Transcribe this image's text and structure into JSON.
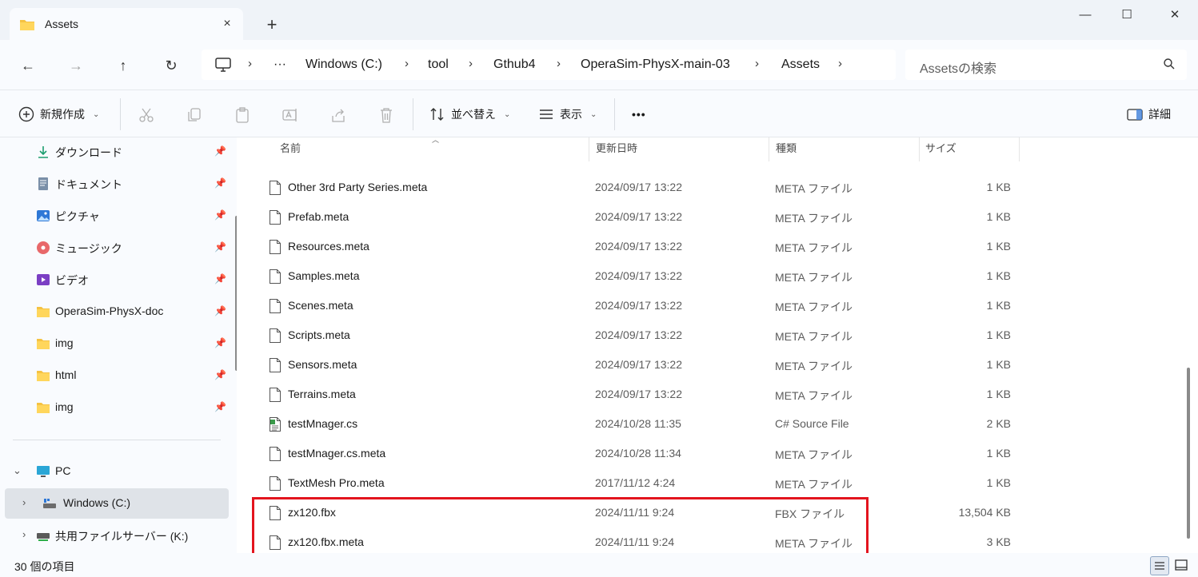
{
  "window": {
    "tab_title": "Assets",
    "tab_close": "×",
    "new_tab": "+",
    "minimize": "—",
    "maximize": "☐",
    "close": "✕"
  },
  "nav": {
    "back": "←",
    "forward": "→",
    "up": "↑",
    "refresh": "↻"
  },
  "breadcrumb": {
    "overflow": "···",
    "items": [
      "Windows (C:)",
      "tool",
      "Gthub4",
      "OperaSim-PhysX-main-03",
      "Assets"
    ],
    "separator": "›"
  },
  "search": {
    "placeholder": "Assetsの検索"
  },
  "toolbar": {
    "new_label": "新規作成",
    "sort_label": "並べ替え",
    "view_label": "表示",
    "more_label": "•••",
    "details_label": "詳細"
  },
  "sidebar": {
    "quick_access": [
      {
        "label": "ダウンロード",
        "icon": "download-icon"
      },
      {
        "label": "ドキュメント",
        "icon": "document-icon"
      },
      {
        "label": "ピクチャ",
        "icon": "pictures-icon"
      },
      {
        "label": "ミュージック",
        "icon": "music-icon"
      },
      {
        "label": "ビデオ",
        "icon": "video-icon"
      },
      {
        "label": "OperaSim-PhysX-doc",
        "icon": "folder-icon"
      },
      {
        "label": "img",
        "icon": "folder-icon"
      },
      {
        "label": "html",
        "icon": "folder-icon"
      },
      {
        "label": "img",
        "icon": "folder-icon"
      }
    ],
    "pc_label": "PC",
    "windows_label": "Windows (C:)",
    "share_label": "共用ファイルサーバー (K:)"
  },
  "columns": {
    "name": "名前",
    "date": "更新日時",
    "type": "種類",
    "size": "サイズ"
  },
  "files": [
    {
      "name": "Other 3rd Party Series.meta",
      "date": "2024/09/17 13:22",
      "type": "META ファイル",
      "size": "1 KB",
      "icon": "file"
    },
    {
      "name": "Prefab.meta",
      "date": "2024/09/17 13:22",
      "type": "META ファイル",
      "size": "1 KB",
      "icon": "file"
    },
    {
      "name": "Resources.meta",
      "date": "2024/09/17 13:22",
      "type": "META ファイル",
      "size": "1 KB",
      "icon": "file"
    },
    {
      "name": "Samples.meta",
      "date": "2024/09/17 13:22",
      "type": "META ファイル",
      "size": "1 KB",
      "icon": "file"
    },
    {
      "name": "Scenes.meta",
      "date": "2024/09/17 13:22",
      "type": "META ファイル",
      "size": "1 KB",
      "icon": "file"
    },
    {
      "name": "Scripts.meta",
      "date": "2024/09/17 13:22",
      "type": "META ファイル",
      "size": "1 KB",
      "icon": "file"
    },
    {
      "name": "Sensors.meta",
      "date": "2024/09/17 13:22",
      "type": "META ファイル",
      "size": "1 KB",
      "icon": "file"
    },
    {
      "name": "Terrains.meta",
      "date": "2024/09/17 13:22",
      "type": "META ファイル",
      "size": "1 KB",
      "icon": "file"
    },
    {
      "name": "testMnager.cs",
      "date": "2024/10/28 11:35",
      "type": "C# Source File",
      "size": "2 KB",
      "icon": "cs"
    },
    {
      "name": "testMnager.cs.meta",
      "date": "2024/10/28 11:34",
      "type": "META ファイル",
      "size": "1 KB",
      "icon": "file"
    },
    {
      "name": "TextMesh Pro.meta",
      "date": "2017/11/12 4:24",
      "type": "META ファイル",
      "size": "1 KB",
      "icon": "file"
    },
    {
      "name": "zx120.fbx",
      "date": "2024/11/11 9:24",
      "type": "FBX ファイル",
      "size": "13,504 KB",
      "icon": "file"
    },
    {
      "name": "zx120.fbx.meta",
      "date": "2024/11/11 9:24",
      "type": "META ファイル",
      "size": "3 KB",
      "icon": "file"
    }
  ],
  "status": {
    "item_count": "30 個の項目"
  },
  "colors": {
    "highlight": "#e3141e",
    "selected_bg": "#dfe3e8",
    "folder": "#f5c242"
  }
}
